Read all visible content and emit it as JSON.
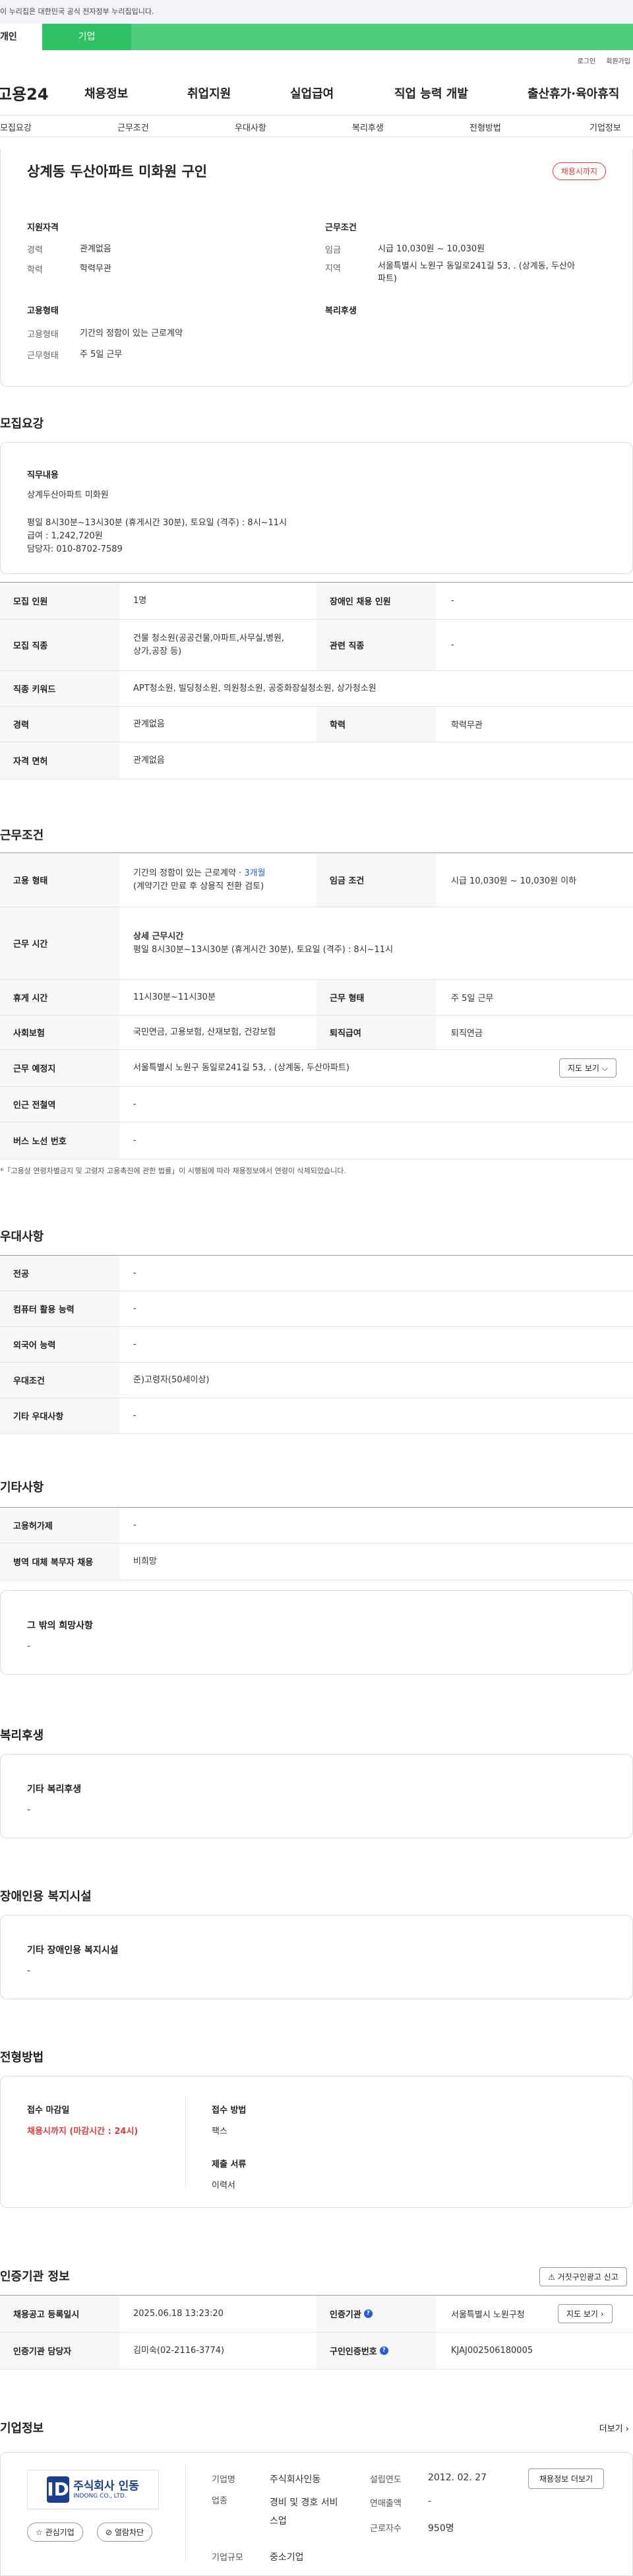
{
  "gov_banner": "이 누리집은 대한민국 공식 전자정부 누리집입니다.",
  "tabs": {
    "person": "개인",
    "corp": "기업"
  },
  "util": {
    "login": "로그인",
    "join": "회원가입"
  },
  "nav": {
    "logo": "고용24",
    "items": [
      "채용정보",
      "취업지원",
      "실업급여",
      "직업 능력 개발",
      "출산휴가·육아휴직"
    ]
  },
  "subnav": [
    "모집요강",
    "근무조건",
    "우대사항",
    "복리후생",
    "전형방법",
    "기업정보"
  ],
  "summary": {
    "title": "상계동 두산아파트 미화원 구인",
    "deadline": "채용시까지",
    "qual_head": "지원자격",
    "career_lbl": "경력",
    "career_val": "관계없음",
    "edu_lbl": "학력",
    "edu_val": "학력무관",
    "emp_head": "고용형태",
    "emp_type_lbl": "고용형태",
    "emp_type_val": "기간의 정함이 있는 근로계약",
    "work_type_lbl": "근무형태",
    "work_type_val": "주 5일 근무",
    "cond_head": "근무조건",
    "wage_lbl": "임금",
    "wage_val": "시급 10,030원 ~ 10,030원",
    "area_lbl": "지역",
    "area_val1": "서울특별시 노원구 동일로241길 53, . (상계동, 두산아",
    "area_val2": "파트)",
    "welfare_head": "복리후생"
  },
  "recruit": {
    "section_title": "모집요강",
    "duty_lbl": "직무내용",
    "duty_lines": [
      "상계두산아파트 미화원",
      "평일 8시30분~13시30분 (휴게시간 30분), 토요일 (격주) : 8시~11시",
      "급여 : 1,242,720원",
      "담당자: 010-8702-7589"
    ],
    "rows": {
      "count_lbl": "모집 인원",
      "count_val": "1명",
      "disabled_lbl": "장애인 채용 인원",
      "disabled_val": "-",
      "job_lbl": "모집 직종",
      "job_val1": "건물 청소원(공공건물,아파트,사무실,병원,",
      "job_val2": "상가,공장 등)",
      "related_lbl": "관련 직종",
      "related_val": "-",
      "keyword_lbl": "직종 키워드",
      "keyword_val": "APT청소원, 빌딩청소원, 의원청소원, 공중화장실청소원, 상가청소원",
      "career_lbl": "경력",
      "career_val": "관계없음",
      "edu_lbl": "학력",
      "edu_val": "학력무관",
      "license_lbl": "자격 면허",
      "license_val": "관계없음"
    }
  },
  "work": {
    "section_title": "근무조건",
    "emp_lbl": "고용 형태",
    "emp_val1": "기간의 정함이 있는 근로계약 · ",
    "emp_months": "3개월",
    "emp_val2": "(계약기간 만료 후 상용직 전환 검토)",
    "wage_lbl": "임금 조건",
    "wage_val": "시급 10,030원 ~ 10,030원 이하",
    "time_lbl": "근무 시간",
    "time_head": "상세 근무시간",
    "time_val": "평일 8시30분~13시30분 (휴게시간 30분), 토요일 (격주) : 8시~11시",
    "break_lbl": "휴게 시간",
    "break_val": "11시30분~11시30분",
    "form_lbl": "근무 형태",
    "form_val": "주 5일 근무",
    "ins_lbl": "사회보험",
    "ins_val": "국민연금, 고용보험, 산재보험, 건강보험",
    "retire_lbl": "퇴직급여",
    "retire_val": "퇴직연금",
    "place_lbl": "근무 예정지",
    "place_val": "서울특별시 노원구 동일로241길 53, . (상계동, 두산아파트)",
    "map_btn": "지도 보기",
    "subway_lbl": "인근 전철역",
    "subway_val": "-",
    "bus_lbl": "버스 노선 번호",
    "bus_val": "-",
    "note": "*「고용상 연령차별금지 및 고령자 고용촉진에 관한 법률」이 시행됨에 따라 채용정보에서 연령이 삭제되었습니다."
  },
  "pref": {
    "section_title": "우대사항",
    "major_lbl": "전공",
    "major_val": "-",
    "pc_lbl": "컴퓨터 활용 능력",
    "pc_val": "-",
    "lang_lbl": "외국어 능력",
    "lang_val": "-",
    "cond_lbl": "우대조건",
    "cond_val": "준)고령자(50세이상)",
    "etc_lbl": "기타 우대사항",
    "etc_val": "-"
  },
  "etc": {
    "section_title": "기타사항",
    "permit_lbl": "고용허가제",
    "permit_val": "-",
    "military_lbl": "병역 대체 복무자 채용",
    "military_val": "비희망",
    "other_lbl": "그 밖의 희망사항",
    "other_val": "-"
  },
  "welfare": {
    "section_title": "복리후생",
    "lbl": "기타 복리후생",
    "val": "-"
  },
  "disabled": {
    "section_title": "장애인용 복지시설",
    "lbl": "기타 장애인용 복지시설",
    "val": "-"
  },
  "process": {
    "section_title": "전형방법",
    "deadline_lbl": "접수 마감일",
    "deadline_val": "채용시까지 (마감시간 : 24시)",
    "method_lbl": "접수 방법",
    "method_val": "팩스",
    "docs_lbl": "제출 서류",
    "docs_val": "이력서"
  },
  "cert": {
    "section_title": "인증기관 정보",
    "report_btn": "거짓구인광고 신고",
    "reg_lbl": "채용공고 등록일시",
    "reg_val": "2025.06.18 13:23:20",
    "agency_lbl": "인증기관",
    "agency_val": "서울특별시 노원구청",
    "map_btn": "지도 보기",
    "mgr_lbl": "인증기관 담당자",
    "mgr_val": "김미숙(02-2116-3774)",
    "no_lbl": "구인인증번호",
    "no_val": "KJAJ002506180005"
  },
  "company": {
    "section_title": "기업정보",
    "more": "더보기",
    "logo_mark": "ID",
    "logo_name": "주식회사 인동",
    "logo_sub": "INDONG CO., LTD.",
    "fav_btn": "관심기업",
    "block_btn": "열람차단",
    "name_lbl": "기업명",
    "name_val": "주식회사인동",
    "biz_lbl": "업종",
    "biz_val1": "경비 및 경호 서비",
    "biz_val2": "스업",
    "size_lbl": "기업규모",
    "size_val": "중소기업",
    "est_lbl": "설립연도",
    "est_val": "2012. 02. 27",
    "sales_lbl": "연매출액",
    "sales_val": "-",
    "emp_lbl": "근로자수",
    "emp_val": "950명",
    "jobs_btn": "채용정보 더보기"
  }
}
